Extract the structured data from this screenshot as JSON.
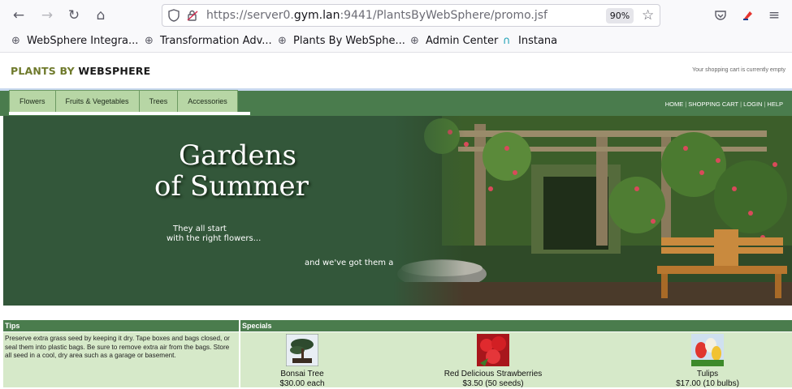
{
  "browser": {
    "url_prefix": "https://server0.",
    "url_domain": "gym.lan",
    "url_suffix": ":9441/PlantsByWebSphere/promo.jsf",
    "zoom": "90%",
    "bookmarks": [
      {
        "label": "WebSphere Integra...",
        "icon": "globe-icon"
      },
      {
        "label": "Transformation Adv...",
        "icon": "globe-icon"
      },
      {
        "label": "Plants By WebSphe...",
        "icon": "globe-icon"
      },
      {
        "label": "Admin Center",
        "icon": "globe-icon"
      },
      {
        "label": "Instana",
        "icon": "instana-icon"
      }
    ]
  },
  "site": {
    "logo_part1": "PLANTS BY ",
    "logo_part2": "WEBSPHERE",
    "cart_status": "Your shopping cart is currently empty",
    "categories": [
      "Flowers",
      "Fruits & Vegetables",
      "Trees",
      "Accessories"
    ],
    "top_links": [
      "HOME",
      "SHOPPING CART",
      "LOGIN",
      "HELP"
    ]
  },
  "banner": {
    "title_line1": "Gardens",
    "title_line2": "of Summer",
    "sub_line1": "They all start",
    "sub_line2": "with the right flowers...",
    "tagline": "and we've got them all"
  },
  "tips": {
    "heading": "Tips",
    "text": "Preserve extra grass seed by keeping it dry. Tape boxes and bags closed, or seal them into plastic bags. Be sure to remove extra air from the bags. Store all seed in a cool, dry area such as a garage or basement."
  },
  "specials": {
    "heading": "Specials",
    "items": [
      {
        "name": "Bonsai Tree",
        "price": "$30.00 each"
      },
      {
        "name": "Red Delicious Strawberries",
        "price": "$3.50 (50 seeds)"
      },
      {
        "name": "Tulips",
        "price": "$17.00 (10 bulbs)"
      }
    ]
  },
  "colors": {
    "nav_green": "#4a7c4d",
    "panel_green": "#d6e9c9",
    "tab_green": "#b7d6a5",
    "banner_green": "#33573a"
  }
}
